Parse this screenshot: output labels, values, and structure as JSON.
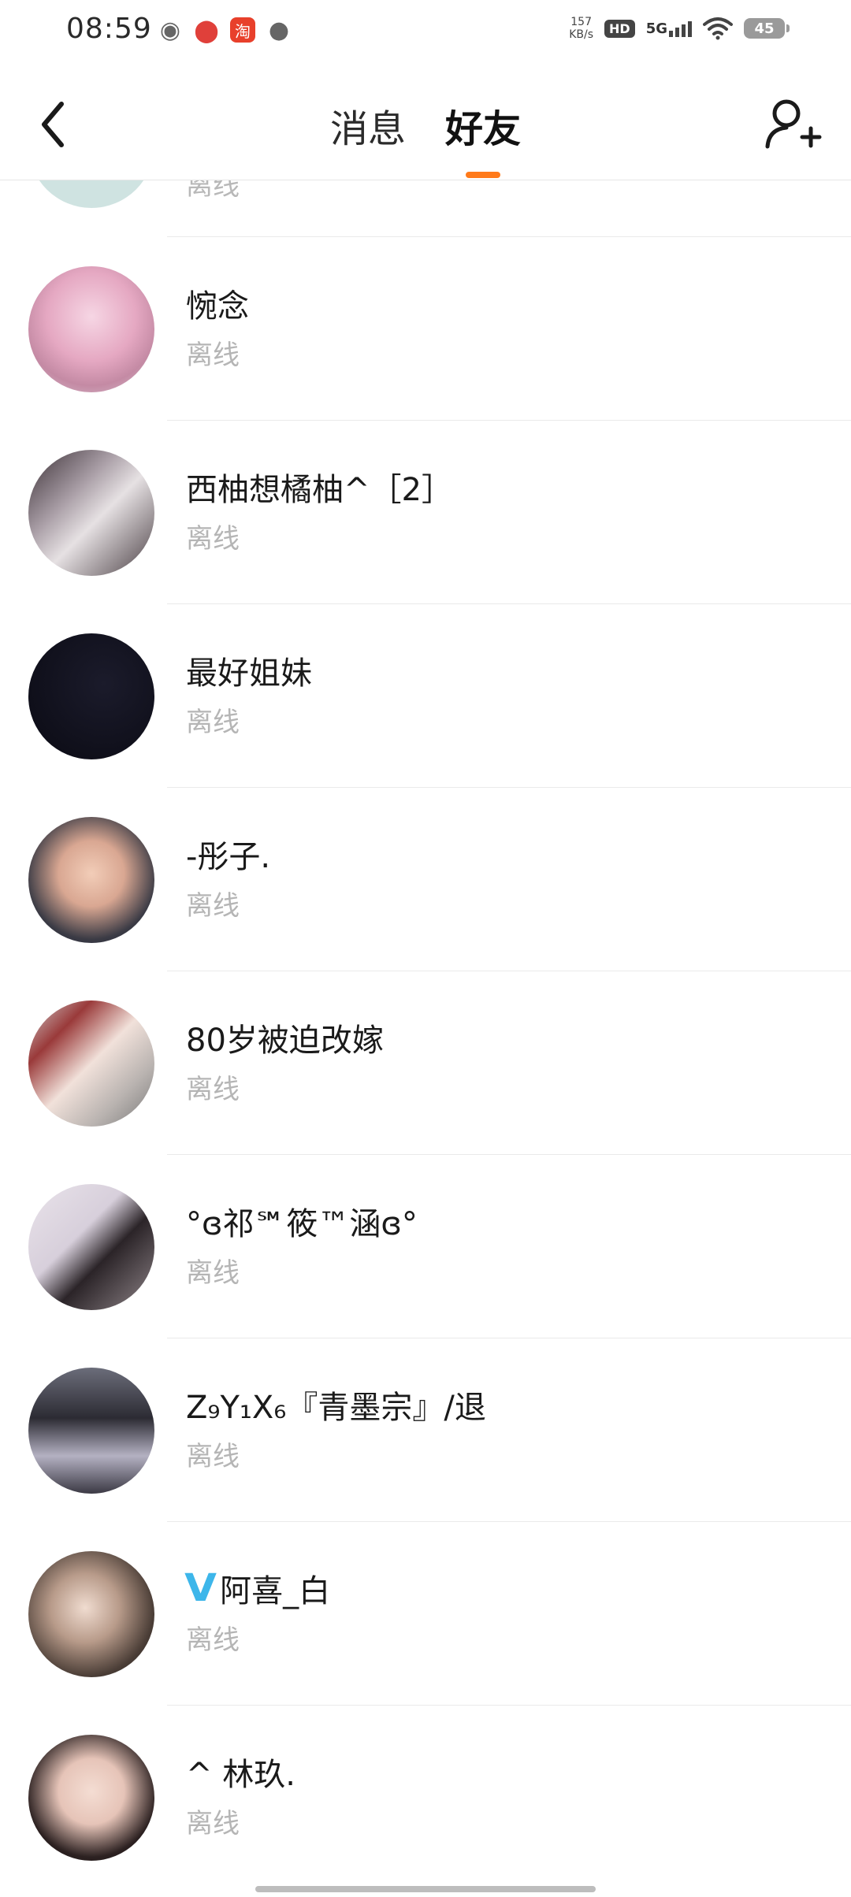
{
  "status_bar": {
    "time": "08:59",
    "speed_value": "157",
    "speed_unit": "KB/s",
    "hd": "HD",
    "network": "5G",
    "battery": "45",
    "tao_label": "淘"
  },
  "header": {
    "tabs": [
      {
        "label": "消息",
        "active": false
      },
      {
        "label": "好友",
        "active": true
      }
    ],
    "accent_color": "#ff7a1a"
  },
  "partial_row": {
    "status": "离线"
  },
  "friends": [
    {
      "name": "惋念",
      "status": "离线"
    },
    {
      "name": "西柚想橘柚^［2］",
      "status": "离线"
    },
    {
      "name": "最好姐妹",
      "status": "离线"
    },
    {
      "name": "-彤子.",
      "status": "离线"
    },
    {
      "name": "80岁被迫改嫁",
      "status": "离线"
    },
    {
      "name": "°ɞ祁℠筱™涵ɞ°",
      "status": "离线"
    },
    {
      "name": "Z₉Y₁X₆『青墨宗』/退",
      "status": "离线"
    },
    {
      "name": "阿喜_白",
      "vip": "V",
      "status": "离线"
    },
    {
      "name": "^ 林玖.",
      "status": "离线"
    }
  ]
}
